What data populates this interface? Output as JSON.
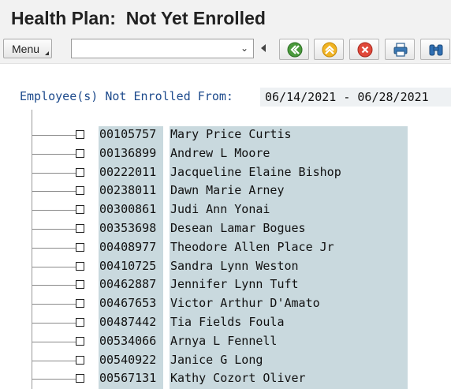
{
  "window": {
    "title": "Health Plan:  Not Yet Enrolled"
  },
  "toolbar": {
    "menu_label": "Menu",
    "command_field_value": "",
    "buttons": [
      {
        "name": "back-button",
        "icon": "back-icon"
      },
      {
        "name": "exit-button",
        "icon": "exit-icon"
      },
      {
        "name": "cancel-button",
        "icon": "cancel-icon"
      },
      {
        "name": "print-button",
        "icon": "printer-icon"
      },
      {
        "name": "find-button",
        "icon": "binoculars-icon"
      }
    ]
  },
  "report": {
    "header_label": "Employee(s) Not Enrolled From:",
    "date_range": "06/14/2021 - 06/28/2021",
    "rows": [
      {
        "id": "00105757",
        "name": "Mary Price Curtis"
      },
      {
        "id": "00136899",
        "name": "Andrew L Moore"
      },
      {
        "id": "00222011",
        "name": "Jacqueline Elaine Bishop"
      },
      {
        "id": "00238011",
        "name": "Dawn Marie Arney"
      },
      {
        "id": "00300861",
        "name": "Judi Ann Yonai"
      },
      {
        "id": "00353698",
        "name": "Desean Lamar Bogues"
      },
      {
        "id": "00408977",
        "name": "Theodore Allen Place Jr"
      },
      {
        "id": "00410725",
        "name": "Sandra Lynn Weston"
      },
      {
        "id": "00462887",
        "name": "Jennifer Lynn Tuft"
      },
      {
        "id": "00467653",
        "name": "Victor Arthur D'Amato"
      },
      {
        "id": "00487442",
        "name": "Tia Fields Foula"
      },
      {
        "id": "00534066",
        "name": "Arnya L Fennell"
      },
      {
        "id": "00540922",
        "name": "Janice G Long"
      },
      {
        "id": "00567131",
        "name": "Kathy Cozort Oliver"
      }
    ]
  }
}
